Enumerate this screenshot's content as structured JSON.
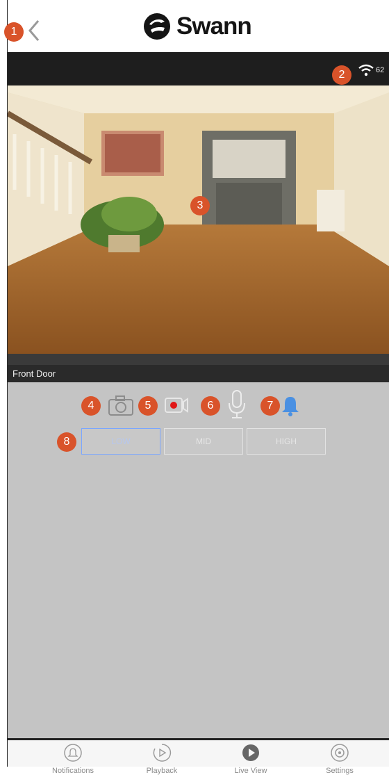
{
  "header": {
    "brand": "Swann"
  },
  "status": {
    "signal_value": "62"
  },
  "camera": {
    "name": "Front Door"
  },
  "quality": {
    "options": [
      "LOW",
      "MID",
      "HIGH"
    ],
    "selected": "LOW"
  },
  "tabs": [
    {
      "label": "Notifications"
    },
    {
      "label": "Playback"
    },
    {
      "label": "Live View"
    },
    {
      "label": "Settings"
    }
  ],
  "callouts": [
    "1",
    "2",
    "3",
    "4",
    "5",
    "6",
    "7",
    "8"
  ],
  "colors": {
    "callout": "#d9532a",
    "bell": "#4a90e2",
    "record": "#e01616",
    "selected_border": "#7aa6ff"
  }
}
